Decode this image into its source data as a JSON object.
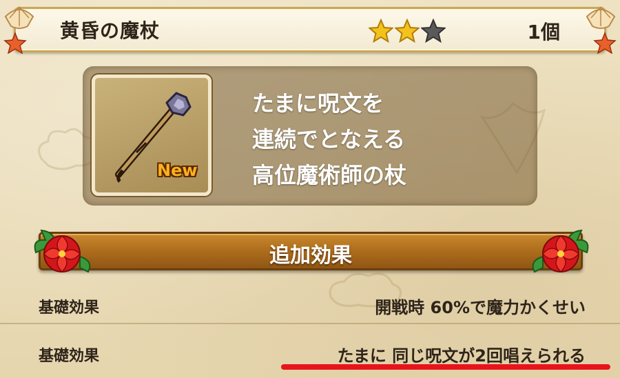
{
  "header": {
    "title": "黄昏の魔杖",
    "rating": {
      "filled": 2,
      "total": 3
    },
    "quantity": "1個"
  },
  "item": {
    "icon": "staff-icon",
    "badge": "New",
    "description": [
      "たまに呪文を",
      "連続でとなえる",
      "高位魔術師の杖"
    ]
  },
  "banner": {
    "label": "追加効果"
  },
  "effects": [
    {
      "label": "基礎効果",
      "value": "開戦時 60%で魔力かくせい"
    },
    {
      "label": "基礎効果",
      "value": "たまに 同じ呪文が2回唱えられる"
    }
  ],
  "colors": {
    "star_filled": "#f4c21c",
    "star_empty": "#5a5a5a",
    "banner": "#b06f1d",
    "highlight_underline": "#e8141c"
  }
}
